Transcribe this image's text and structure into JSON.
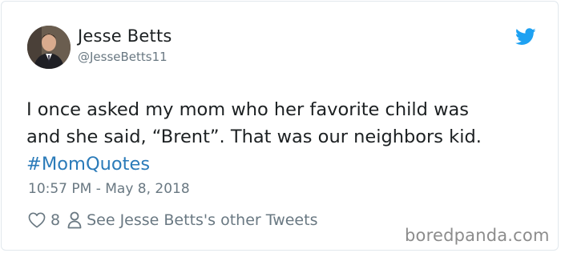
{
  "tweet": {
    "author": {
      "name": "Jesse Betts",
      "handle": "@JesseBetts11",
      "avatar_icon": "profile-photo"
    },
    "brand_icon": "twitter-bird-icon",
    "text_lines": [
      "I once asked my mom who her favorite child was",
      "and she said, “Brent”. That was our neighbors kid."
    ],
    "hashtag": "#MomQuotes",
    "timestamp": "10:57 PM - May 8, 2018",
    "like_count": "8",
    "other_tweets_label": "See Jesse Betts's other Tweets"
  },
  "watermark": "boredpanda.com",
  "colors": {
    "text": "#1c2022",
    "secondary": "#697882",
    "link": "#2b7bb9",
    "twitter_blue": "#1da1f2",
    "border": "#e1e8ed"
  }
}
